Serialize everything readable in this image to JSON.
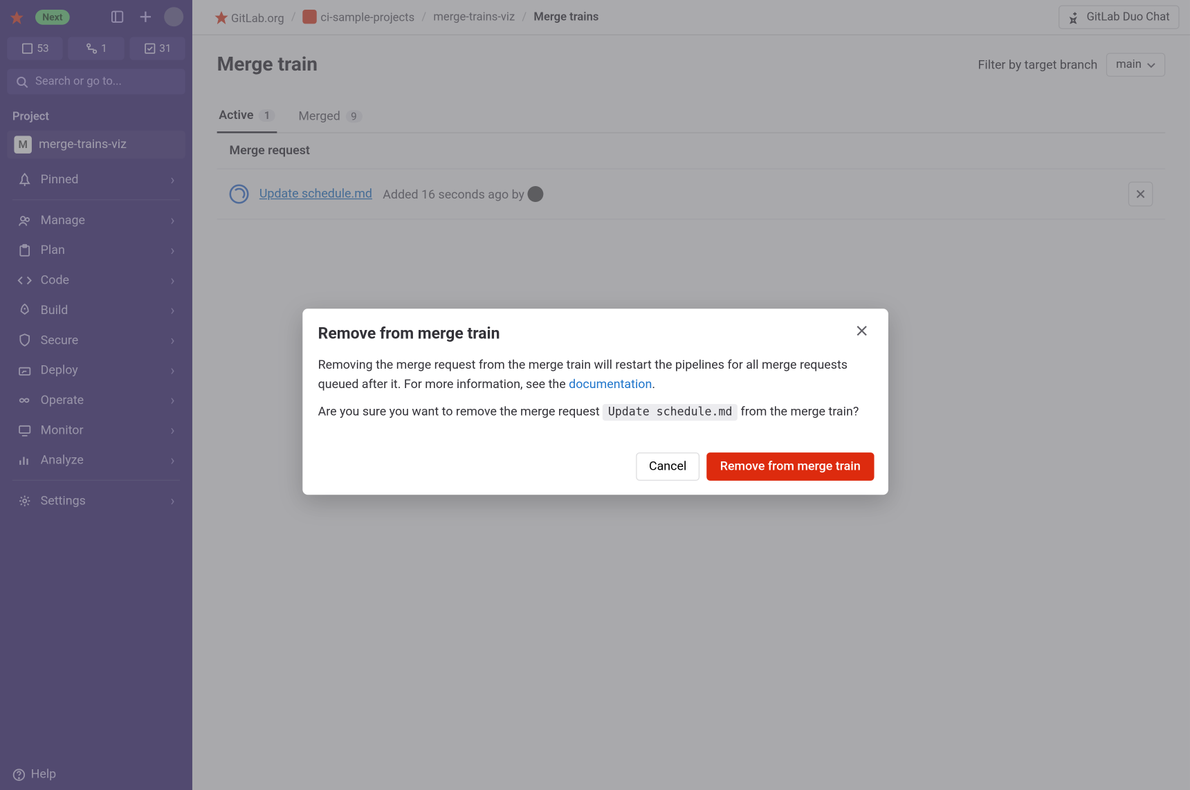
{
  "topbar": {
    "breadcrumbs": {
      "root": "GitLab.org",
      "group": "ci-sample-projects",
      "project": "merge-trains-viz",
      "page": "Merge trains"
    },
    "duo_chat": "GitLab Duo Chat"
  },
  "sidebar": {
    "next_badge": "Next",
    "counts": {
      "files": "53",
      "mrs": "1",
      "todos": "31"
    },
    "search_placeholder": "Search or go to...",
    "section_label": "Project",
    "project_letter": "M",
    "project_name": "merge-trains-viz",
    "items": [
      {
        "label": "Pinned",
        "icon": "pin",
        "expandable": true
      },
      {
        "label": "Manage",
        "icon": "users",
        "expandable": true
      },
      {
        "label": "Plan",
        "icon": "clipboard",
        "expandable": true
      },
      {
        "label": "Code",
        "icon": "code",
        "expandable": true
      },
      {
        "label": "Build",
        "icon": "rocket",
        "expandable": true
      },
      {
        "label": "Secure",
        "icon": "shield",
        "expandable": true
      },
      {
        "label": "Deploy",
        "icon": "deploy",
        "expandable": true
      },
      {
        "label": "Operate",
        "icon": "infinity",
        "expandable": true
      },
      {
        "label": "Monitor",
        "icon": "monitor",
        "expandable": true
      },
      {
        "label": "Analyze",
        "icon": "chart",
        "expandable": true
      },
      {
        "label": "Settings",
        "icon": "gear",
        "expandable": true
      }
    ],
    "help": "Help"
  },
  "page": {
    "title": "Merge train",
    "filter_label": "Filter by target branch",
    "filter_value": "main",
    "tabs": [
      {
        "label": "Active",
        "count": "1",
        "active": true
      },
      {
        "label": "Merged",
        "count": "9",
        "active": false
      }
    ],
    "table_header": "Merge request",
    "rows": [
      {
        "title": "Update schedule.md",
        "meta_prefix": "Added ",
        "meta_time": "16 seconds ago",
        "meta_by": " by "
      }
    ]
  },
  "modal": {
    "title": "Remove from merge train",
    "body_p1_a": "Removing the merge request from the merge train will restart the pipelines for all merge requests queued after it. For more information, see the ",
    "body_p1_link": "documentation",
    "body_p1_b": ".",
    "body_p2_a": "Are you sure you want to remove the merge request ",
    "body_p2_code": "Update schedule.md",
    "body_p2_b": " from the merge train?",
    "cancel": "Cancel",
    "confirm": "Remove from merge train"
  }
}
